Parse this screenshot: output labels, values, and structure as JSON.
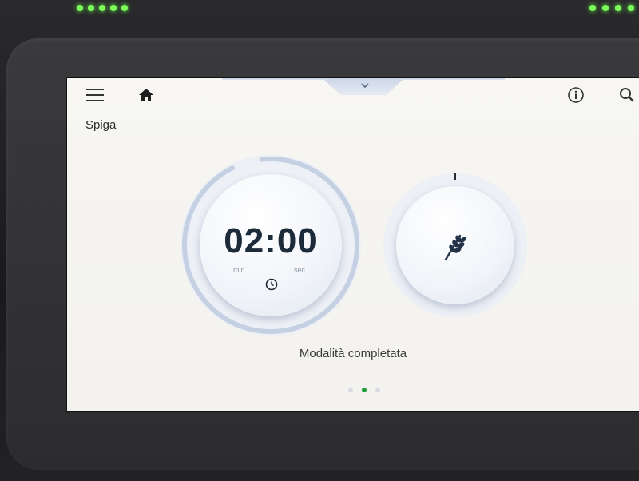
{
  "header": {
    "mode_title": "Spiga",
    "icons": {
      "menu": "hamburger-menu-icon",
      "home": "home-icon",
      "info": "info-icon",
      "search": "search-icon",
      "pull_down": "chevron-down-icon"
    }
  },
  "timer": {
    "value": "02:00",
    "min_label": "min",
    "sec_label": "sec",
    "icon": "clock-icon"
  },
  "grain": {
    "icon": "wheat-ear-icon"
  },
  "status": {
    "text": "Modalità completata"
  },
  "pagination": {
    "count": 3,
    "active_index": 1,
    "active_color": "#1e9e3a"
  },
  "colors": {
    "screen_bg": "#f5f4f0",
    "dial_accent": "#c8d3e5",
    "led_green": "#7dff5a"
  }
}
